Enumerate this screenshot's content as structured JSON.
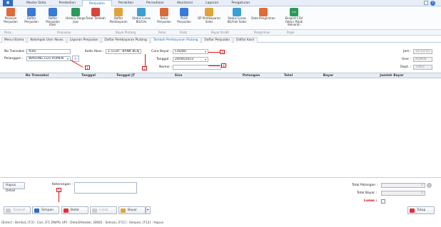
{
  "menubar": {
    "app_icon": "app-menu-icon",
    "tabs": [
      {
        "label": "Master Data",
        "x": 24
      },
      {
        "label": "Pembelian",
        "x": 0
      },
      {
        "label": "Penjualan",
        "x": 0,
        "active": true
      },
      {
        "label": "Persediaan",
        "x": 0
      },
      {
        "label": "Akuntansi",
        "x": 0
      },
      {
        "label": "Laporan",
        "x": 0
      },
      {
        "label": "Pengaturan",
        "x": 0
      }
    ],
    "tab_0": "Master Data",
    "tab_1": "Pembelian",
    "tab_2": "Penjualan",
    "tab_3": "Perakitan",
    "tab_4": "Persediaan",
    "tab_5": "Akuntansi",
    "tab_6": "Laporan",
    "tab_7": "Pengaturan"
  },
  "ribbon": {
    "b0": "Pesanan Penjualan",
    "b1": "Daftar Penjualan",
    "b2": "Daftar Penjualan Kasir",
    "b3": "History Harga Jual",
    "b4": "Tukar Tambah",
    "b5": "Daftar Pembayaran",
    "b6": "Status Lunas BG/Cek",
    "b7": "Retur Penjualan",
    "b8": "Point Penjualan",
    "b9": "DP Pembayaran Sales",
    "b10": "Status Lunas BG/Cek Sales",
    "b11": "Data Pengiriman",
    "b12": "Eksport CSV Faktur Pajak Keluaran"
  },
  "groups": {
    "g0": "Pesa...",
    "g1": "Penjualan",
    "g2": "Bayar Piutang",
    "g3": "Retur",
    "g4": "Point",
    "g5": "Bayar Kredit",
    "g6": "Pengiriman",
    "g7": "Pajak"
  },
  "subtabs": {
    "t0": "Menu Utama",
    "t1": "Kelompok User Akses",
    "t2": "Laporan Penjualan",
    "t3": "Daftar Pembayaran Piutang",
    "t4": "Tambah Pembayaran Piutang",
    "t5": "Daftar Penjualan",
    "t6": "Daftar Kasir"
  },
  "form": {
    "no_transaksi_label": "No Transaksi :",
    "no_transaksi_value": "Auto",
    "pelanggan_label": "Pelanggan :",
    "pelanggan_value": "WARUNG CEU POMEN",
    "kode_akun_label": "Kode Akun :",
    "kode_akun_value": "1-1120 - BANK BCA",
    "cara_bayar_label": "Cara Bayar :",
    "cara_bayar_value": "Cek/BG",
    "tanggal_label": "Tanggal :",
    "tanggal_value": "24/06/2023",
    "nomor_label": "Nomor :",
    "nomor_value": "",
    "jam_label": "Jam :",
    "jam_value": "14:33:55",
    "user_label": "User :",
    "user_value": "ADMIN",
    "dept_label": "Dept. :",
    "dept_value": "TOKO"
  },
  "markers": {
    "m1": "1",
    "m2": "2",
    "m3": "3",
    "m4": "4",
    "m5": "5"
  },
  "grid": {
    "columns": [
      "No Transaksi",
      "Tanggal",
      "Tanggal JT",
      "Sisa",
      "Potongan",
      "Total",
      "Bayar",
      "Jumlah Bayar"
    ]
  },
  "bottom": {
    "hapus_detail": "Hapus Detail",
    "keterangan_label": "Keterangan :",
    "total_potongan_label": "Total Potongan :",
    "total_potongan_value": "0",
    "total_bayar_label": "Total Bayar :",
    "total_bayar_value": "0",
    "lunas_label": "Lunas :",
    "btn_tambah": "Tambah",
    "btn_simpan": "Simpan",
    "btn_batal": "Batal",
    "btn_cetak": "Cetak",
    "btn_bayar": "Bayar",
    "btn_tutup": "Tutup"
  },
  "statusbar": "[Enter] : Berikut, [F3] : Cari, [F1 DN/PG UP] : Detail/Header, [END] : Selesai, [F11] : Simpan, [F12] : Hapus",
  "colors": {
    "accent": "#1f5fbf",
    "marker": "#dd1111"
  }
}
